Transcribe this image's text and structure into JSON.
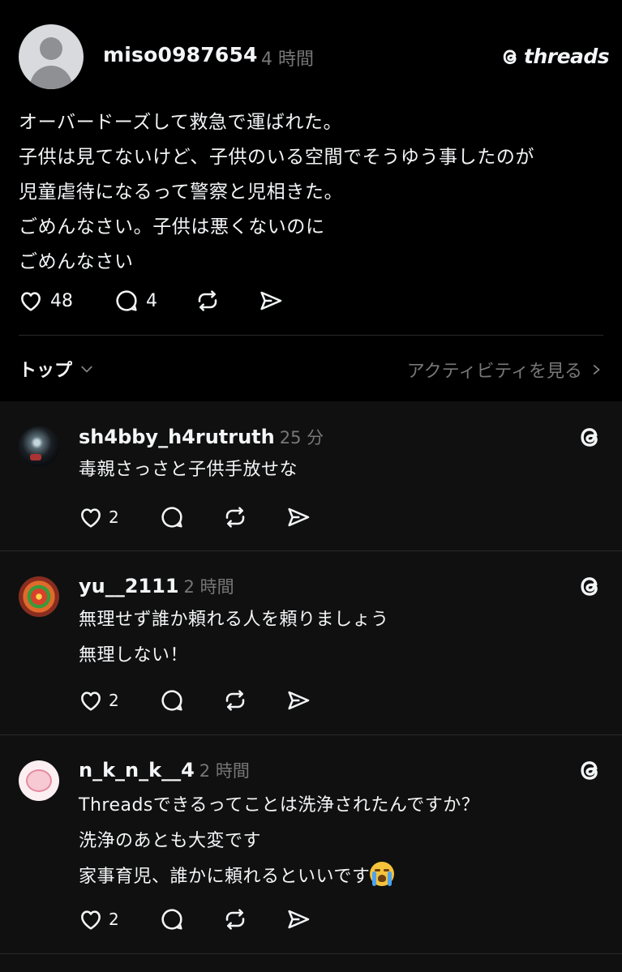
{
  "post": {
    "username": "miso0987654",
    "time": "4 時間",
    "brand": "threads",
    "lines": [
      "オーバードーズして救急で運ばれた。",
      "子供は見てないけど、子供のいる空間でそうゆう事したのが",
      "児童虐待になるって警察と児相きた。",
      "ごめんなさい。子供は悪くないのに",
      "ごめんなさい"
    ],
    "likes": "48",
    "replies": "4"
  },
  "sort": {
    "label": "トップ",
    "activity_link": "アクティビティを見る"
  },
  "comments": [
    {
      "username": "sh4bby_h4rutruth",
      "time": "25 分",
      "lines": [
        "毒親さっさと子供手放せな"
      ],
      "likes": "2"
    },
    {
      "username": "yu__2111",
      "time": "2 時間",
      "lines": [
        "無理せず誰か頼れる人を頼りましょう",
        "無理しない！"
      ],
      "likes": "2"
    },
    {
      "username": "n_k_n_k__4",
      "time": "2 時間",
      "lines": [
        "Threadsできるってことは洗浄されたんですか？",
        "洗浄のあとも大変です",
        "家事育児、誰かに頼れるといいです"
      ],
      "likes": "2",
      "emoji": "loudly-crying-face"
    }
  ],
  "icons": [
    "heart-icon",
    "comment-icon",
    "repost-icon",
    "share-icon",
    "threads-logo-icon",
    "chevron-down-icon",
    "chevron-right-icon"
  ]
}
